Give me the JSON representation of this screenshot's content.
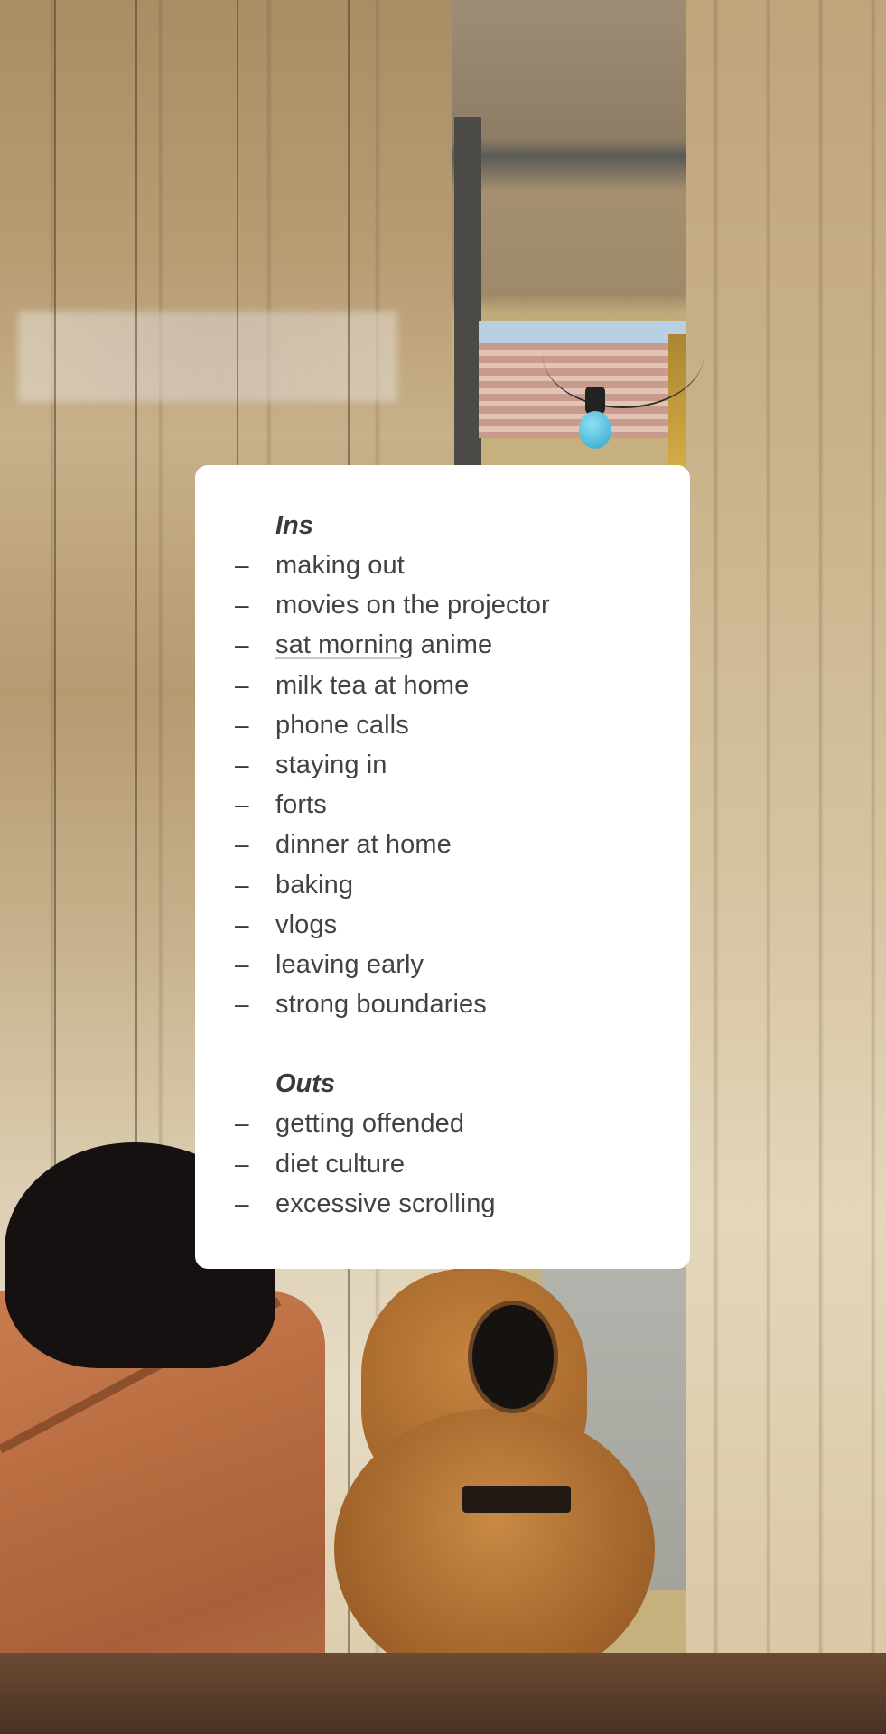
{
  "background": {
    "description": "photo of sheer beige curtains by a window, a black cat on an orange couch, and an acoustic guitar on a stand",
    "accent_colors": {
      "curtain": "#c7b08a",
      "couch": "#b5693e",
      "guitar": "#c5843f",
      "bulb": "#2fa4d0"
    }
  },
  "note": {
    "sections": [
      {
        "title": "Ins",
        "items": [
          {
            "text": "making out"
          },
          {
            "text": "movies on the projector"
          },
          {
            "text": "sat morning",
            "text_after": " anime",
            "underlined": true
          },
          {
            "text": "milk tea at home"
          },
          {
            "text": "phone calls"
          },
          {
            "text": "staying in"
          },
          {
            "text": "forts"
          },
          {
            "text": "dinner at home"
          },
          {
            "text": "baking"
          },
          {
            "text": "vlogs"
          },
          {
            "text": "leaving early"
          },
          {
            "text": "strong boundaries"
          }
        ]
      },
      {
        "title": "Outs",
        "items": [
          {
            "text": "getting offended"
          },
          {
            "text": "diet culture"
          },
          {
            "text": "excessive scrolling"
          }
        ]
      }
    ],
    "bullet": "–",
    "colors": {
      "card": "#ffffff",
      "text": "#424244",
      "underline": "#c9c9cc"
    }
  }
}
